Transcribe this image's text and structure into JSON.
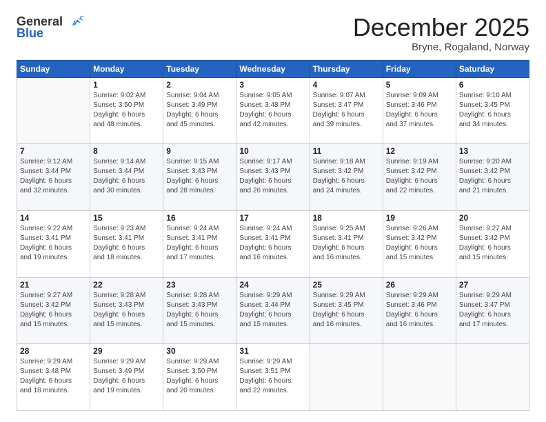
{
  "logo": {
    "general": "General",
    "blue": "Blue"
  },
  "title": "December 2025",
  "location": "Bryne, Rogaland, Norway",
  "weekdays": [
    "Sunday",
    "Monday",
    "Tuesday",
    "Wednesday",
    "Thursday",
    "Friday",
    "Saturday"
  ],
  "weeks": [
    [
      {
        "day": "",
        "sunrise": "",
        "sunset": "",
        "daylight": ""
      },
      {
        "day": "1",
        "sunrise": "Sunrise: 9:02 AM",
        "sunset": "Sunset: 3:50 PM",
        "daylight": "Daylight: 6 hours and 48 minutes."
      },
      {
        "day": "2",
        "sunrise": "Sunrise: 9:04 AM",
        "sunset": "Sunset: 3:49 PM",
        "daylight": "Daylight: 6 hours and 45 minutes."
      },
      {
        "day": "3",
        "sunrise": "Sunrise: 9:05 AM",
        "sunset": "Sunset: 3:48 PM",
        "daylight": "Daylight: 6 hours and 42 minutes."
      },
      {
        "day": "4",
        "sunrise": "Sunrise: 9:07 AM",
        "sunset": "Sunset: 3:47 PM",
        "daylight": "Daylight: 6 hours and 39 minutes."
      },
      {
        "day": "5",
        "sunrise": "Sunrise: 9:09 AM",
        "sunset": "Sunset: 3:46 PM",
        "daylight": "Daylight: 6 hours and 37 minutes."
      },
      {
        "day": "6",
        "sunrise": "Sunrise: 9:10 AM",
        "sunset": "Sunset: 3:45 PM",
        "daylight": "Daylight: 6 hours and 34 minutes."
      }
    ],
    [
      {
        "day": "7",
        "sunrise": "Sunrise: 9:12 AM",
        "sunset": "Sunset: 3:44 PM",
        "daylight": "Daylight: 6 hours and 32 minutes."
      },
      {
        "day": "8",
        "sunrise": "Sunrise: 9:14 AM",
        "sunset": "Sunset: 3:44 PM",
        "daylight": "Daylight: 6 hours and 30 minutes."
      },
      {
        "day": "9",
        "sunrise": "Sunrise: 9:15 AM",
        "sunset": "Sunset: 3:43 PM",
        "daylight": "Daylight: 6 hours and 28 minutes."
      },
      {
        "day": "10",
        "sunrise": "Sunrise: 9:17 AM",
        "sunset": "Sunset: 3:43 PM",
        "daylight": "Daylight: 6 hours and 26 minutes."
      },
      {
        "day": "11",
        "sunrise": "Sunrise: 9:18 AM",
        "sunset": "Sunset: 3:42 PM",
        "daylight": "Daylight: 6 hours and 24 minutes."
      },
      {
        "day": "12",
        "sunrise": "Sunrise: 9:19 AM",
        "sunset": "Sunset: 3:42 PM",
        "daylight": "Daylight: 6 hours and 22 minutes."
      },
      {
        "day": "13",
        "sunrise": "Sunrise: 9:20 AM",
        "sunset": "Sunset: 3:42 PM",
        "daylight": "Daylight: 6 hours and 21 minutes."
      }
    ],
    [
      {
        "day": "14",
        "sunrise": "Sunrise: 9:22 AM",
        "sunset": "Sunset: 3:41 PM",
        "daylight": "Daylight: 6 hours and 19 minutes."
      },
      {
        "day": "15",
        "sunrise": "Sunrise: 9:23 AM",
        "sunset": "Sunset: 3:41 PM",
        "daylight": "Daylight: 6 hours and 18 minutes."
      },
      {
        "day": "16",
        "sunrise": "Sunrise: 9:24 AM",
        "sunset": "Sunset: 3:41 PM",
        "daylight": "Daylight: 6 hours and 17 minutes."
      },
      {
        "day": "17",
        "sunrise": "Sunrise: 9:24 AM",
        "sunset": "Sunset: 3:41 PM",
        "daylight": "Daylight: 6 hours and 16 minutes."
      },
      {
        "day": "18",
        "sunrise": "Sunrise: 9:25 AM",
        "sunset": "Sunset: 3:41 PM",
        "daylight": "Daylight: 6 hours and 16 minutes."
      },
      {
        "day": "19",
        "sunrise": "Sunrise: 9:26 AM",
        "sunset": "Sunset: 3:42 PM",
        "daylight": "Daylight: 6 hours and 15 minutes."
      },
      {
        "day": "20",
        "sunrise": "Sunrise: 9:27 AM",
        "sunset": "Sunset: 3:42 PM",
        "daylight": "Daylight: 6 hours and 15 minutes."
      }
    ],
    [
      {
        "day": "21",
        "sunrise": "Sunrise: 9:27 AM",
        "sunset": "Sunset: 3:42 PM",
        "daylight": "Daylight: 6 hours and 15 minutes."
      },
      {
        "day": "22",
        "sunrise": "Sunrise: 9:28 AM",
        "sunset": "Sunset: 3:43 PM",
        "daylight": "Daylight: 6 hours and 15 minutes."
      },
      {
        "day": "23",
        "sunrise": "Sunrise: 9:28 AM",
        "sunset": "Sunset: 3:43 PM",
        "daylight": "Daylight: 6 hours and 15 minutes."
      },
      {
        "day": "24",
        "sunrise": "Sunrise: 9:29 AM",
        "sunset": "Sunset: 3:44 PM",
        "daylight": "Daylight: 6 hours and 15 minutes."
      },
      {
        "day": "25",
        "sunrise": "Sunrise: 9:29 AM",
        "sunset": "Sunset: 3:45 PM",
        "daylight": "Daylight: 6 hours and 16 minutes."
      },
      {
        "day": "26",
        "sunrise": "Sunrise: 9:29 AM",
        "sunset": "Sunset: 3:46 PM",
        "daylight": "Daylight: 6 hours and 16 minutes."
      },
      {
        "day": "27",
        "sunrise": "Sunrise: 9:29 AM",
        "sunset": "Sunset: 3:47 PM",
        "daylight": "Daylight: 6 hours and 17 minutes."
      }
    ],
    [
      {
        "day": "28",
        "sunrise": "Sunrise: 9:29 AM",
        "sunset": "Sunset: 3:48 PM",
        "daylight": "Daylight: 6 hours and 18 minutes."
      },
      {
        "day": "29",
        "sunrise": "Sunrise: 9:29 AM",
        "sunset": "Sunset: 3:49 PM",
        "daylight": "Daylight: 6 hours and 19 minutes."
      },
      {
        "day": "30",
        "sunrise": "Sunrise: 9:29 AM",
        "sunset": "Sunset: 3:50 PM",
        "daylight": "Daylight: 6 hours and 20 minutes."
      },
      {
        "day": "31",
        "sunrise": "Sunrise: 9:29 AM",
        "sunset": "Sunset: 3:51 PM",
        "daylight": "Daylight: 6 hours and 22 minutes."
      },
      {
        "day": "",
        "sunrise": "",
        "sunset": "",
        "daylight": ""
      },
      {
        "day": "",
        "sunrise": "",
        "sunset": "",
        "daylight": ""
      },
      {
        "day": "",
        "sunrise": "",
        "sunset": "",
        "daylight": ""
      }
    ]
  ]
}
